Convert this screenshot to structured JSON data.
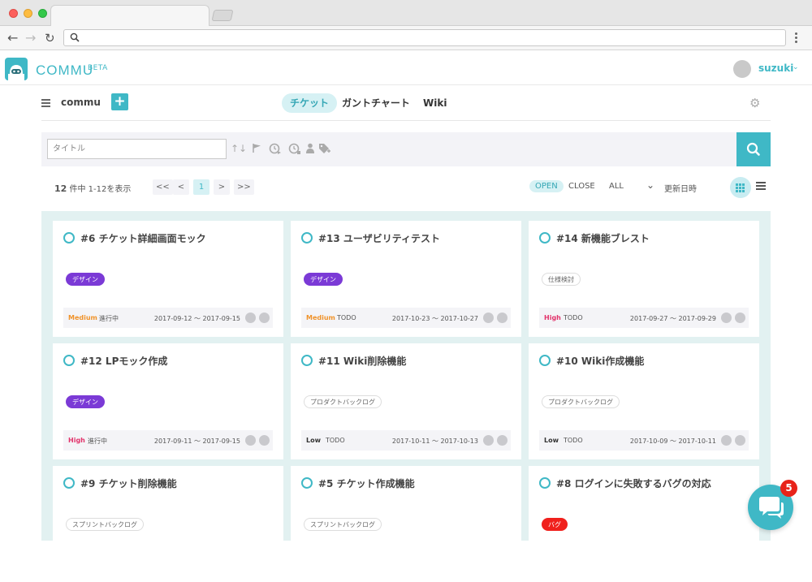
{
  "app": {
    "logo_text": "COMMU",
    "logo_badge": "BETA",
    "user_name": "suzuki"
  },
  "subnav": {
    "project": "commu",
    "add_label": "+",
    "tabs": [
      {
        "label": "チケット",
        "active": true
      },
      {
        "label": "ガントチャート",
        "active": false
      },
      {
        "label": "Wiki",
        "active": false
      }
    ]
  },
  "filter": {
    "title_placeholder": "タイトル"
  },
  "list": {
    "count_num": "12",
    "count_text": " 件中 1-12を表示",
    "pagination": [
      "<<",
      "<",
      "1",
      ">",
      ">>"
    ],
    "active_page": "1",
    "status_filters": [
      "OPEN",
      "CLOSE",
      "ALL"
    ],
    "active_status": "OPEN",
    "sort_label": "更新日時"
  },
  "tickets": [
    {
      "title": "#6 チケット詳細画面モック",
      "tag": "デザイン",
      "tag_style": "purple",
      "priority": "Medium",
      "status": "進行中",
      "dates": "2017-09-12 〜 2017-09-15"
    },
    {
      "title": "#13 ユーザビリティテスト",
      "tag": "デザイン",
      "tag_style": "purple",
      "priority": "Medium",
      "status": "TODO",
      "dates": "2017-10-23 〜 2017-10-27"
    },
    {
      "title": "#14 新機能ブレスト",
      "tag": "仕様検討",
      "tag_style": "plain",
      "priority": "High",
      "status": "TODO",
      "dates": "2017-09-27 〜 2017-09-29"
    },
    {
      "title": "#12 LPモック作成",
      "tag": "デザイン",
      "tag_style": "purple",
      "priority": "High",
      "status": "進行中",
      "dates": "2017-09-11 〜 2017-09-15"
    },
    {
      "title": "#11 Wiki削除機能",
      "tag": "プロダクトバックログ",
      "tag_style": "plain",
      "priority": "Low",
      "status": "TODO",
      "dates": "2017-10-11 〜 2017-10-13"
    },
    {
      "title": "#10 Wiki作成機能",
      "tag": "プロダクトバックログ",
      "tag_style": "plain",
      "priority": "Low",
      "status": "TODO",
      "dates": "2017-10-09 〜 2017-10-11"
    },
    {
      "title": "#9 チケット削除機能",
      "tag": "スプリントバックログ",
      "tag_style": "plain",
      "priority": "",
      "status": "",
      "dates": ""
    },
    {
      "title": "#5 チケット作成機能",
      "tag": "スプリントバックログ",
      "tag_style": "plain",
      "priority": "",
      "status": "",
      "dates": ""
    },
    {
      "title": "#8 ログインに失敗するバグの対応",
      "tag": "バグ",
      "tag_style": "red",
      "priority": "",
      "status": "",
      "dates": ""
    }
  ],
  "chat": {
    "unread_count": "5"
  },
  "colors": {
    "accent": "#3fb8c6",
    "priority_medium": "#f0932b",
    "priority_high": "#e2336b",
    "priority_low": "#333333"
  },
  "icons": {
    "filter_icons": [
      "sort-arrows-icon",
      "flag-icon",
      "clock-start-icon",
      "clock-end-icon",
      "person-icon",
      "tag-icon"
    ]
  }
}
